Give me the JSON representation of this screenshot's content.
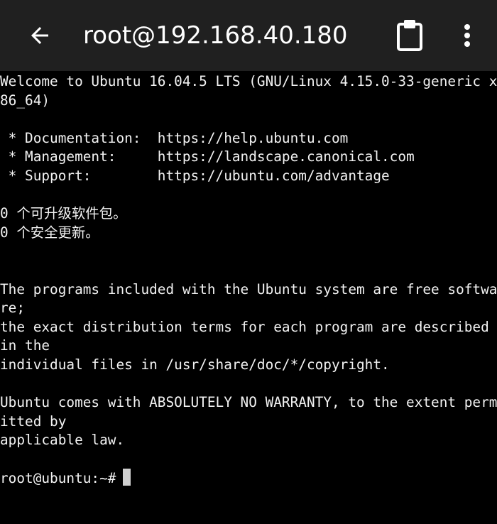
{
  "header": {
    "title": "root@192.168.40.180",
    "back_icon": "arrow-left-icon",
    "clipboard_icon": "clipboard-icon",
    "menu_icon": "more-vert-icon"
  },
  "colors": {
    "header_bg": "#202020",
    "terminal_bg": "#000000",
    "terminal_fg": "#f2f2f2",
    "cursor": "#cfcfcf"
  },
  "terminal": {
    "lines": [
      "Welcome to Ubuntu 16.04.5 LTS (GNU/Linux 4.15.0-33-generic x",
      "86_64)",
      "",
      " * Documentation:  https://help.ubuntu.com",
      " * Management:     https://landscape.canonical.com",
      " * Support:        https://ubuntu.com/advantage",
      "",
      "0 个可升级软件包。",
      "0 个安全更新。",
      "",
      "",
      "The programs included with the Ubuntu system are free softwa",
      "re;",
      "the exact distribution terms for each program are described",
      "in the",
      "individual files in /usr/share/doc/*/copyright.",
      "",
      "Ubuntu comes with ABSOLUTELY NO WARRANTY, to the extent perm",
      "itted by",
      "applicable law.",
      ""
    ],
    "prompt": "root@ubuntu:~#"
  }
}
